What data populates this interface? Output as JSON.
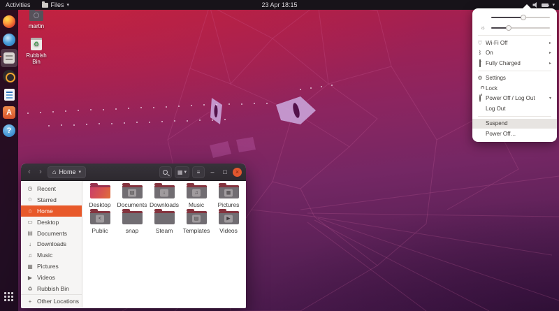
{
  "colors": {
    "accent": "#e95420",
    "selection": "#e8592a",
    "close_button": "#e2572e",
    "wallpaper_top": "#b51e3f",
    "wallpaper_bottom": "#3d1642"
  },
  "topbar": {
    "activities": "Activities",
    "app_menu": "Files",
    "clock": "23 Apr 18:15"
  },
  "icons": {
    "caret_down": "▾",
    "arrow_right": "▸",
    "back": "‹",
    "forward": "›",
    "home": "⌂",
    "grid_view": "▦",
    "menu": "≡",
    "minimize": "–",
    "maximize": "□",
    "close": "×",
    "sun": "☼",
    "wifi": "♡",
    "bluetooth": "ᛒ",
    "recycle": "♻"
  },
  "dock": {
    "items": [
      {
        "name": "firefox"
      },
      {
        "name": "thunderbird"
      },
      {
        "name": "files",
        "active": true
      },
      {
        "name": "rhythmbox"
      },
      {
        "name": "libreoffice-writer"
      },
      {
        "name": "ubuntu-software",
        "glyph": "A"
      },
      {
        "name": "help",
        "glyph": "?"
      }
    ],
    "show_apps": "show-applications"
  },
  "desktop": {
    "icons": [
      {
        "label": "martin"
      },
      {
        "label": "Rubbish Bin",
        "glyph": "♻"
      }
    ]
  },
  "system_menu": {
    "volume_percent": 55,
    "brightness_percent": 30,
    "wifi": {
      "label": "Wi-Fi Off"
    },
    "bluetooth": {
      "label": "On"
    },
    "battery": {
      "label": "Fully Charged"
    },
    "settings": "Settings",
    "lock": "Lock",
    "power_menu": "Power Off / Log Out",
    "log_out": "Log Out",
    "suspend": "Suspend",
    "power_off": "Power Off…"
  },
  "files_window": {
    "location": "Home",
    "sidebar": [
      {
        "label": "Recent",
        "glyph": "◷"
      },
      {
        "label": "Starred",
        "glyph": "☆"
      },
      {
        "label": "Home",
        "glyph": "⌂"
      },
      {
        "label": "Desktop",
        "glyph": "▭"
      },
      {
        "label": "Documents",
        "glyph": "▤"
      },
      {
        "label": "Downloads",
        "glyph": "↓"
      },
      {
        "label": "Music",
        "glyph": "♫"
      },
      {
        "label": "Pictures",
        "glyph": "▦"
      },
      {
        "label": "Videos",
        "glyph": "▶"
      },
      {
        "label": "Rubbish Bin",
        "glyph": "♻"
      },
      {
        "label": "Other Locations",
        "glyph": "+"
      }
    ],
    "folders": [
      {
        "label": "Desktop",
        "emblem": ""
      },
      {
        "label": "Documents",
        "emblem": "▤"
      },
      {
        "label": "Downloads",
        "emblem": "↓"
      },
      {
        "label": "Music",
        "emblem": "♫"
      },
      {
        "label": "Pictures",
        "emblem": "▦"
      },
      {
        "label": "Public",
        "emblem": "<"
      },
      {
        "label": "snap",
        "emblem": ""
      },
      {
        "label": "Steam",
        "emblem": ""
      },
      {
        "label": "Templates",
        "emblem": "▤"
      },
      {
        "label": "Videos",
        "emblem": "▶"
      }
    ]
  }
}
